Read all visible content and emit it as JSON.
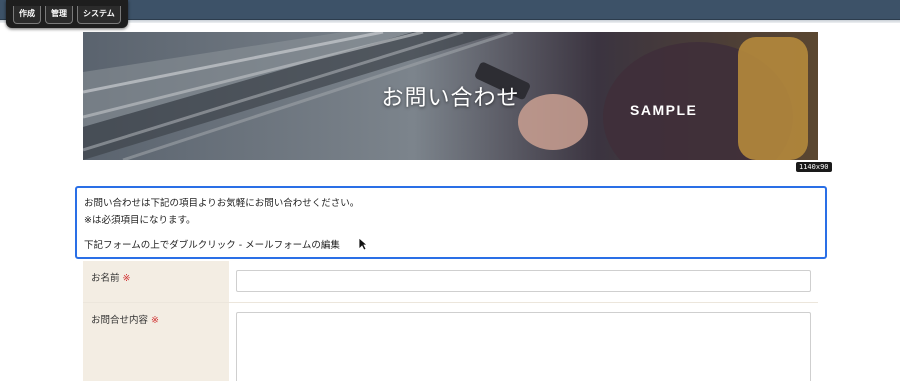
{
  "admin_menu": {
    "items": [
      "作成",
      "管理",
      "システム"
    ]
  },
  "hero": {
    "title": "お問い合わせ",
    "sample_label": "SAMPLE",
    "size_badge": "1140x90"
  },
  "intro": {
    "line1": "お問い合わせは下記の項目よりお気軽にお問い合わせください。",
    "line2": "※は必須項目になります。",
    "edit_hint": "下記フォームの上でダブルクリック - メールフォームの編集"
  },
  "form": {
    "name_label": "お名前",
    "content_label": "お問合せ内容",
    "required_mark": "※"
  },
  "colors": {
    "topbar": "#3d5268",
    "accent_border": "#2a6fe6",
    "label_bg": "#f3ede3",
    "required": "#d23838"
  }
}
